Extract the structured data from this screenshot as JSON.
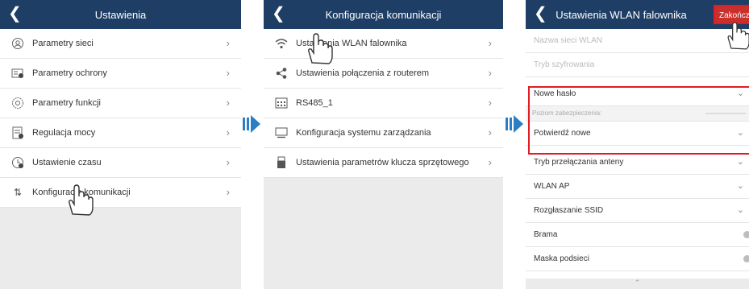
{
  "screen1": {
    "title": "Ustawienia",
    "items": [
      {
        "label": "Parametry sieci",
        "icon": "globe-icon"
      },
      {
        "label": "Parametry ochrony",
        "icon": "protection-icon"
      },
      {
        "label": "Parametry funkcji",
        "icon": "function-icon"
      },
      {
        "label": "Regulacja mocy",
        "icon": "power-icon"
      },
      {
        "label": "Ustawienie czasu",
        "icon": "clock-icon"
      },
      {
        "label": "Konfiguracja komunikacji",
        "icon": "communication-icon"
      }
    ]
  },
  "screen2": {
    "title": "Konfiguracja komunikacji",
    "items": [
      {
        "label": "Ustawienia WLAN falownika",
        "icon": "wifi-icon"
      },
      {
        "label": "Ustawienia połączenia z routerem",
        "icon": "share-icon"
      },
      {
        "label": "RS485_1",
        "icon": "rs485-icon"
      },
      {
        "label": "Konfiguracja systemu zarządzania",
        "icon": "monitor-icon"
      },
      {
        "label": "Ustawienia parametrów klucza sprzętowego",
        "icon": "dongle-icon"
      }
    ]
  },
  "screen3": {
    "title": "Ustawienia WLAN falownika",
    "save_label": "Zakończ",
    "items": {
      "ssid": "Nazwa sieci WLAN",
      "encryption": "Tryb szyfrowania",
      "new_password": "Nowe hasło",
      "security_level": "Poziom zabezpieczenia:",
      "confirm_new": "Potwierdź nowe",
      "antenna": "Tryb przełączania anteny",
      "wlan_ap": "WLAN AP",
      "ssid_broadcast": "Rozgłaszanie SSID",
      "gateway": "Brama",
      "subnet_mask": "Maska podsieci"
    }
  },
  "colors": {
    "header": "#1f3e66",
    "arrow": "#2a7fc4",
    "highlight": "#e31b23"
  }
}
